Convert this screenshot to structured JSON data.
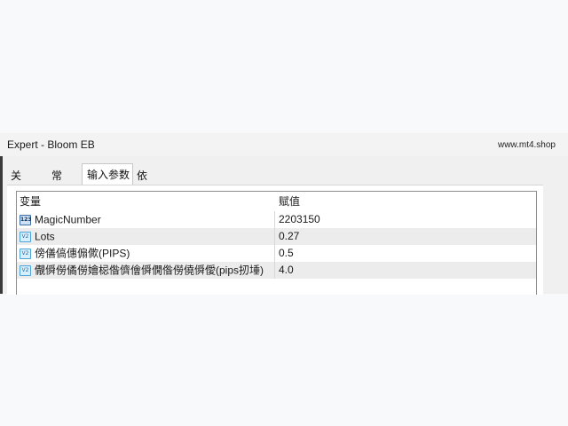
{
  "window": {
    "title": "Expert - Bloom EB",
    "watermark": "www.mt4.shop"
  },
  "tabs": [
    {
      "label": "关于",
      "active": false
    },
    {
      "label": "常用",
      "active": false
    },
    {
      "label": "输入参数",
      "active": true
    },
    {
      "label": "依存关系",
      "active": false
    }
  ],
  "grid": {
    "columns": {
      "name": "变量",
      "value": "赋值"
    },
    "rows": [
      {
        "icon": "integer-type-icon",
        "icon_glyph": "123",
        "name": "MagicNumber",
        "value": "2203150"
      },
      {
        "icon": "double-type-icon",
        "icon_glyph": "V2",
        "name": "Lots",
        "value": "0.27"
      },
      {
        "icon": "double-type-icon",
        "icon_glyph": "V2",
        "name": "傍僐傐僡傓僛(PIPS)",
        "value": "0.5"
      },
      {
        "icon": "double-type-icon",
        "icon_glyph": "V2",
        "name": "儬僢僗僪僗嬒梞偺儕儈僢僩偺僗僥僢僾(pips扨埵)",
        "value": "4.0"
      }
    ]
  }
}
